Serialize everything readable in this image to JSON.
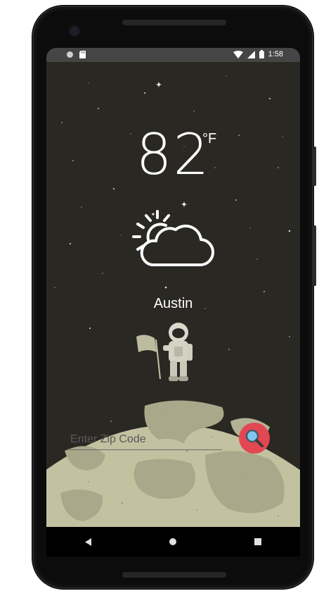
{
  "status_bar": {
    "time": "1:58",
    "left_icons": [
      "circle-icon",
      "sd-card-icon"
    ],
    "right_icons": [
      "wifi-icon",
      "signal-icon",
      "battery-icon"
    ]
  },
  "weather": {
    "temperature": "82",
    "unit": "°F",
    "condition_icon": "partly-cloudy-icon",
    "city": "Austin"
  },
  "search": {
    "placeholder": "Enter Zip Code",
    "value": "",
    "button_icon": "search-magnifier-icon"
  },
  "navigation": {
    "items": [
      "back-icon",
      "home-icon",
      "recents-icon"
    ]
  },
  "colors": {
    "sky": "#2a2823",
    "moon": "#c2c1a0",
    "moon_crater": "#a8a88c",
    "search_button": "#e24752",
    "status_bar": "#454545"
  }
}
